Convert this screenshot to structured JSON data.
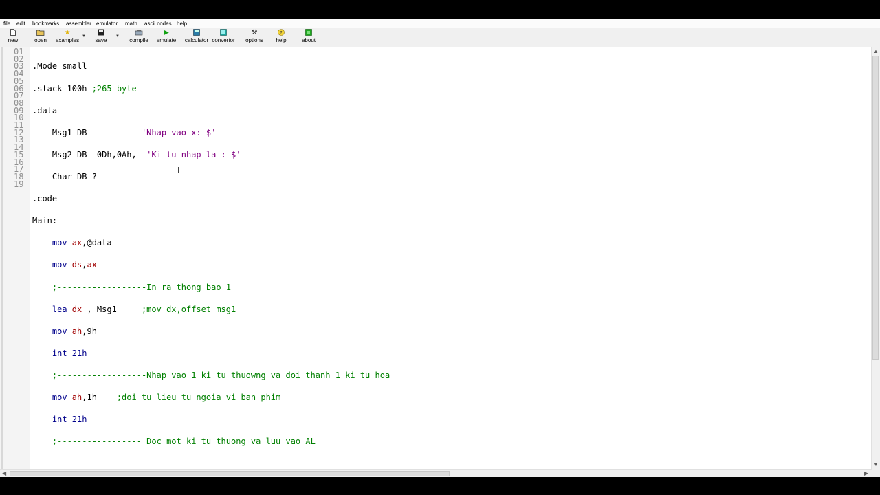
{
  "menu": [
    "file",
    "edit",
    "bookmarks",
    "assembler",
    "emulator",
    "math",
    "ascii codes",
    "help"
  ],
  "toolbar": {
    "new": "new",
    "open": "open",
    "examples": "examples",
    "save": "save",
    "compile": "compile",
    "emulate": "emulate",
    "calculator": "calculator",
    "convertor": "convertor",
    "options": "options",
    "help": "help",
    "about": "about"
  },
  "icons": {
    "new": "document-icon",
    "open": "folder-open-icon",
    "examples": "star-icon",
    "save": "floppy-disk-icon",
    "compile": "compile-icon",
    "emulate": "play-icon",
    "calculator": "calculator-icon",
    "convertor": "convertor-icon",
    "options": "tools-icon",
    "help": "help-question-icon",
    "about": "about-icon"
  },
  "colors": {
    "keyword": "#00008b",
    "register": "#a00000",
    "string": "#800080",
    "comment": "#008000"
  },
  "line_numbers": [
    "01",
    "02",
    "03",
    "04",
    "05",
    "06",
    "07",
    "08",
    "09",
    "10",
    "11",
    "12",
    "13",
    "14",
    "15",
    "16",
    "17",
    "18",
    "19"
  ],
  "code": {
    "l01": ".Mode small",
    "l02a": ".stack 100h ",
    "l02b": ";265 byte",
    "l03": ".data",
    "l04a": "    Msg1 DB           ",
    "l04b": "'Nhap vao x: $'",
    "l05a": "    Msg2 DB  0Dh,0Ah,  ",
    "l05b": "'Ki tu nhap la : $'",
    "l06": "    Char DB ?",
    "l07": ".code",
    "l08": "Main:",
    "l09a": "    mov ",
    "l09b": "ax",
    "l09c": ",@data",
    "l10a": "    mov ",
    "l10b": "ds",
    "l10c": ",",
    "l10d": "ax",
    "l11a": "    ",
    "l11b": ";------------------In ra thong bao 1",
    "l12a": "    lea ",
    "l12b": "dx",
    "l12c": " , Msg1     ",
    "l12d": ";mov dx,offset msg1",
    "l13a": "    mov ",
    "l13b": "ah",
    "l13c": ",9h",
    "l14": "    int 21h",
    "l15a": "    ",
    "l15b": ";------------------Nhap vao 1 ki tu thuowng va doi thanh 1 ki tu hoa",
    "l16a": "    mov ",
    "l16b": "ah",
    "l16c": ",1h    ",
    "l16d": ";doi tu lieu tu ngoia vi ban phim",
    "l17": "    int 21h",
    "l18a": "    ",
    "l18b": ";----------------- Doc mot ki tu thuong va luu vao AL",
    "l19": ""
  }
}
